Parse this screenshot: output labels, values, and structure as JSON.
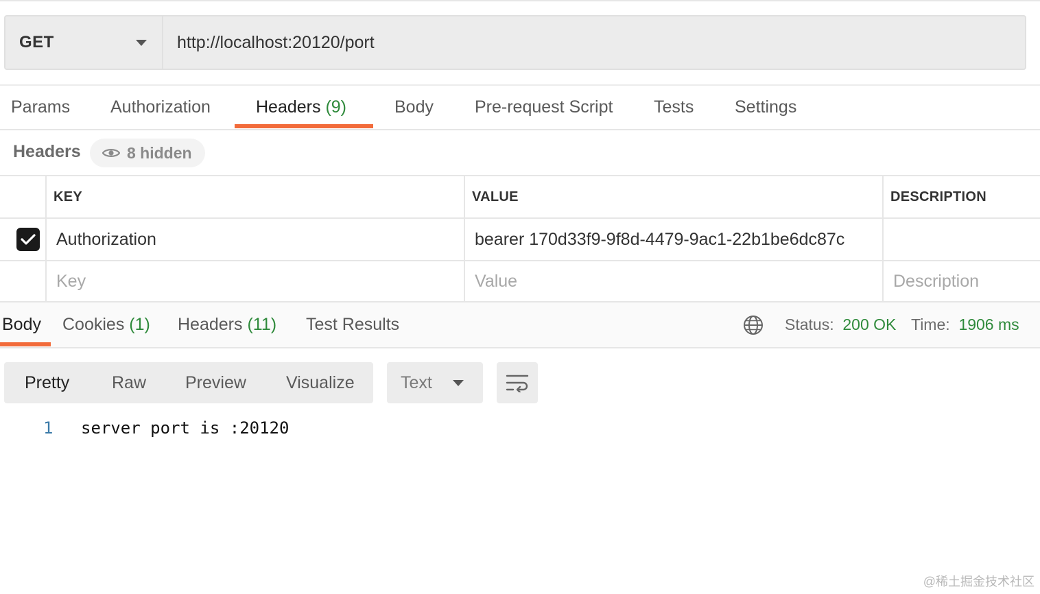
{
  "request": {
    "method": "GET",
    "url": "http://localhost:20120/port"
  },
  "request_tabs": [
    {
      "label": "Params",
      "count": ""
    },
    {
      "label": "Authorization",
      "count": ""
    },
    {
      "label": "Headers",
      "count": "(9)"
    },
    {
      "label": "Body",
      "count": ""
    },
    {
      "label": "Pre-request Script",
      "count": ""
    },
    {
      "label": "Tests",
      "count": ""
    },
    {
      "label": "Settings",
      "count": ""
    }
  ],
  "active_request_tab": "Headers",
  "headers_section": {
    "title": "Headers",
    "hidden_label": "8 hidden",
    "columns": {
      "key": "KEY",
      "value": "VALUE",
      "description": "DESCRIPTION"
    },
    "rows": [
      {
        "checked": true,
        "key": "Authorization",
        "value": "bearer 170d33f9-9f8d-4479-9ac1-22b1be6dc87c",
        "description": ""
      }
    ],
    "placeholders": {
      "key": "Key",
      "value": "Value",
      "description": "Description"
    }
  },
  "response_tabs": [
    {
      "label": "Body",
      "count": ""
    },
    {
      "label": "Cookies",
      "count": "(1)"
    },
    {
      "label": "Headers",
      "count": "(11)"
    },
    {
      "label": "Test Results",
      "count": ""
    }
  ],
  "active_response_tab": "Body",
  "response_status": {
    "status_label": "Status:",
    "status_value": "200 OK",
    "time_label": "Time:",
    "time_value": "1906 ms"
  },
  "format_modes": [
    "Pretty",
    "Raw",
    "Preview",
    "Visualize"
  ],
  "active_format_mode": "Pretty",
  "format_type": "Text",
  "body_lines": [
    {
      "number": "1",
      "text": "server port is :20120"
    }
  ],
  "colors": {
    "accent": "#f26b3a",
    "success": "#2f8a3b",
    "line_number": "#3a7aa8"
  },
  "watermark": "@稀土掘金技术社区"
}
